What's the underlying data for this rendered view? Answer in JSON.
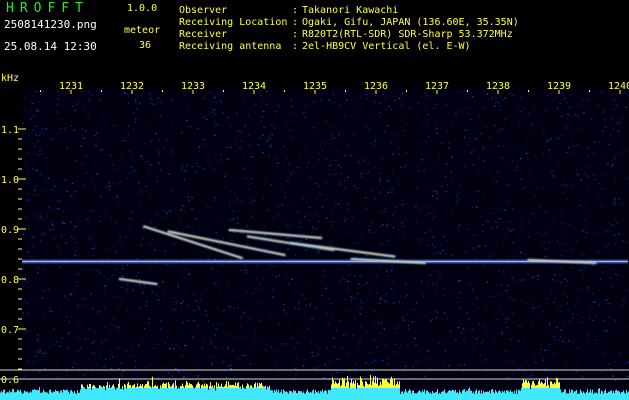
{
  "header": {
    "app_title": "HROFFT",
    "app_version": "1.0.0",
    "file_name": "2508141230.png",
    "mode_label": "meteor",
    "date_time": "25.08.14 12:30",
    "meteor_count": "36"
  },
  "station_info": [
    {
      "label": "Observer",
      "value": "Takanori Kawachi"
    },
    {
      "label": "Receiving Location",
      "value": "Ogaki, Gifu, JAPAN (136.60E, 35.35N)"
    },
    {
      "label": "Receiver",
      "value": "R820T2(RTL-SDR) SDR-Sharp 53.372MHz"
    },
    {
      "label": "Receiving antenna",
      "value": "2el-HB9CV Vertical (el. E-W)"
    }
  ],
  "colon": ":",
  "axes": {
    "y_unit": "kHz",
    "x_tick_labels": [
      "1231",
      "1232",
      "1233",
      "1234",
      "1235",
      "1236",
      "1237",
      "1238",
      "1239",
      "1240"
    ],
    "y_tick_labels": [
      "1.1",
      "1.0",
      "0.9",
      "0.8",
      "0.7",
      "0.6"
    ]
  },
  "chart_data": {
    "type": "heatmap",
    "x_ticks": [
      1231,
      1232,
      1233,
      1234,
      1235,
      1236,
      1237,
      1238,
      1239,
      1240
    ],
    "y_ticks": [
      1.1,
      1.0,
      0.9,
      0.8,
      0.7,
      0.6
    ],
    "ylabel": "kHz",
    "carrier_khz": 0.835,
    "meteor_echoes": [
      {
        "x_start": 1232.2,
        "y_start": 0.905,
        "x_end": 1233.8,
        "y_end": 0.842
      },
      {
        "x_start": 1232.6,
        "y_start": 0.895,
        "x_end": 1234.5,
        "y_end": 0.848
      },
      {
        "x_start": 1233.9,
        "y_start": 0.885,
        "x_end": 1235.3,
        "y_end": 0.858
      },
      {
        "x_start": 1234.6,
        "y_start": 0.872,
        "x_end": 1236.3,
        "y_end": 0.845
      },
      {
        "x_start": 1233.6,
        "y_start": 0.898,
        "x_end": 1235.1,
        "y_end": 0.882
      },
      {
        "x_start": 1235.6,
        "y_start": 0.84,
        "x_end": 1236.8,
        "y_end": 0.832
      },
      {
        "x_start": 1238.5,
        "y_start": 0.838,
        "x_end": 1239.6,
        "y_end": 0.832
      },
      {
        "x_start": 1231.8,
        "y_start": 0.8,
        "x_end": 1232.4,
        "y_end": 0.79
      }
    ],
    "colors": {
      "carrier": "#7090ff",
      "echo": "#ffe060",
      "noise": "#2030a0",
      "level_bar": "#40e8ff"
    }
  }
}
